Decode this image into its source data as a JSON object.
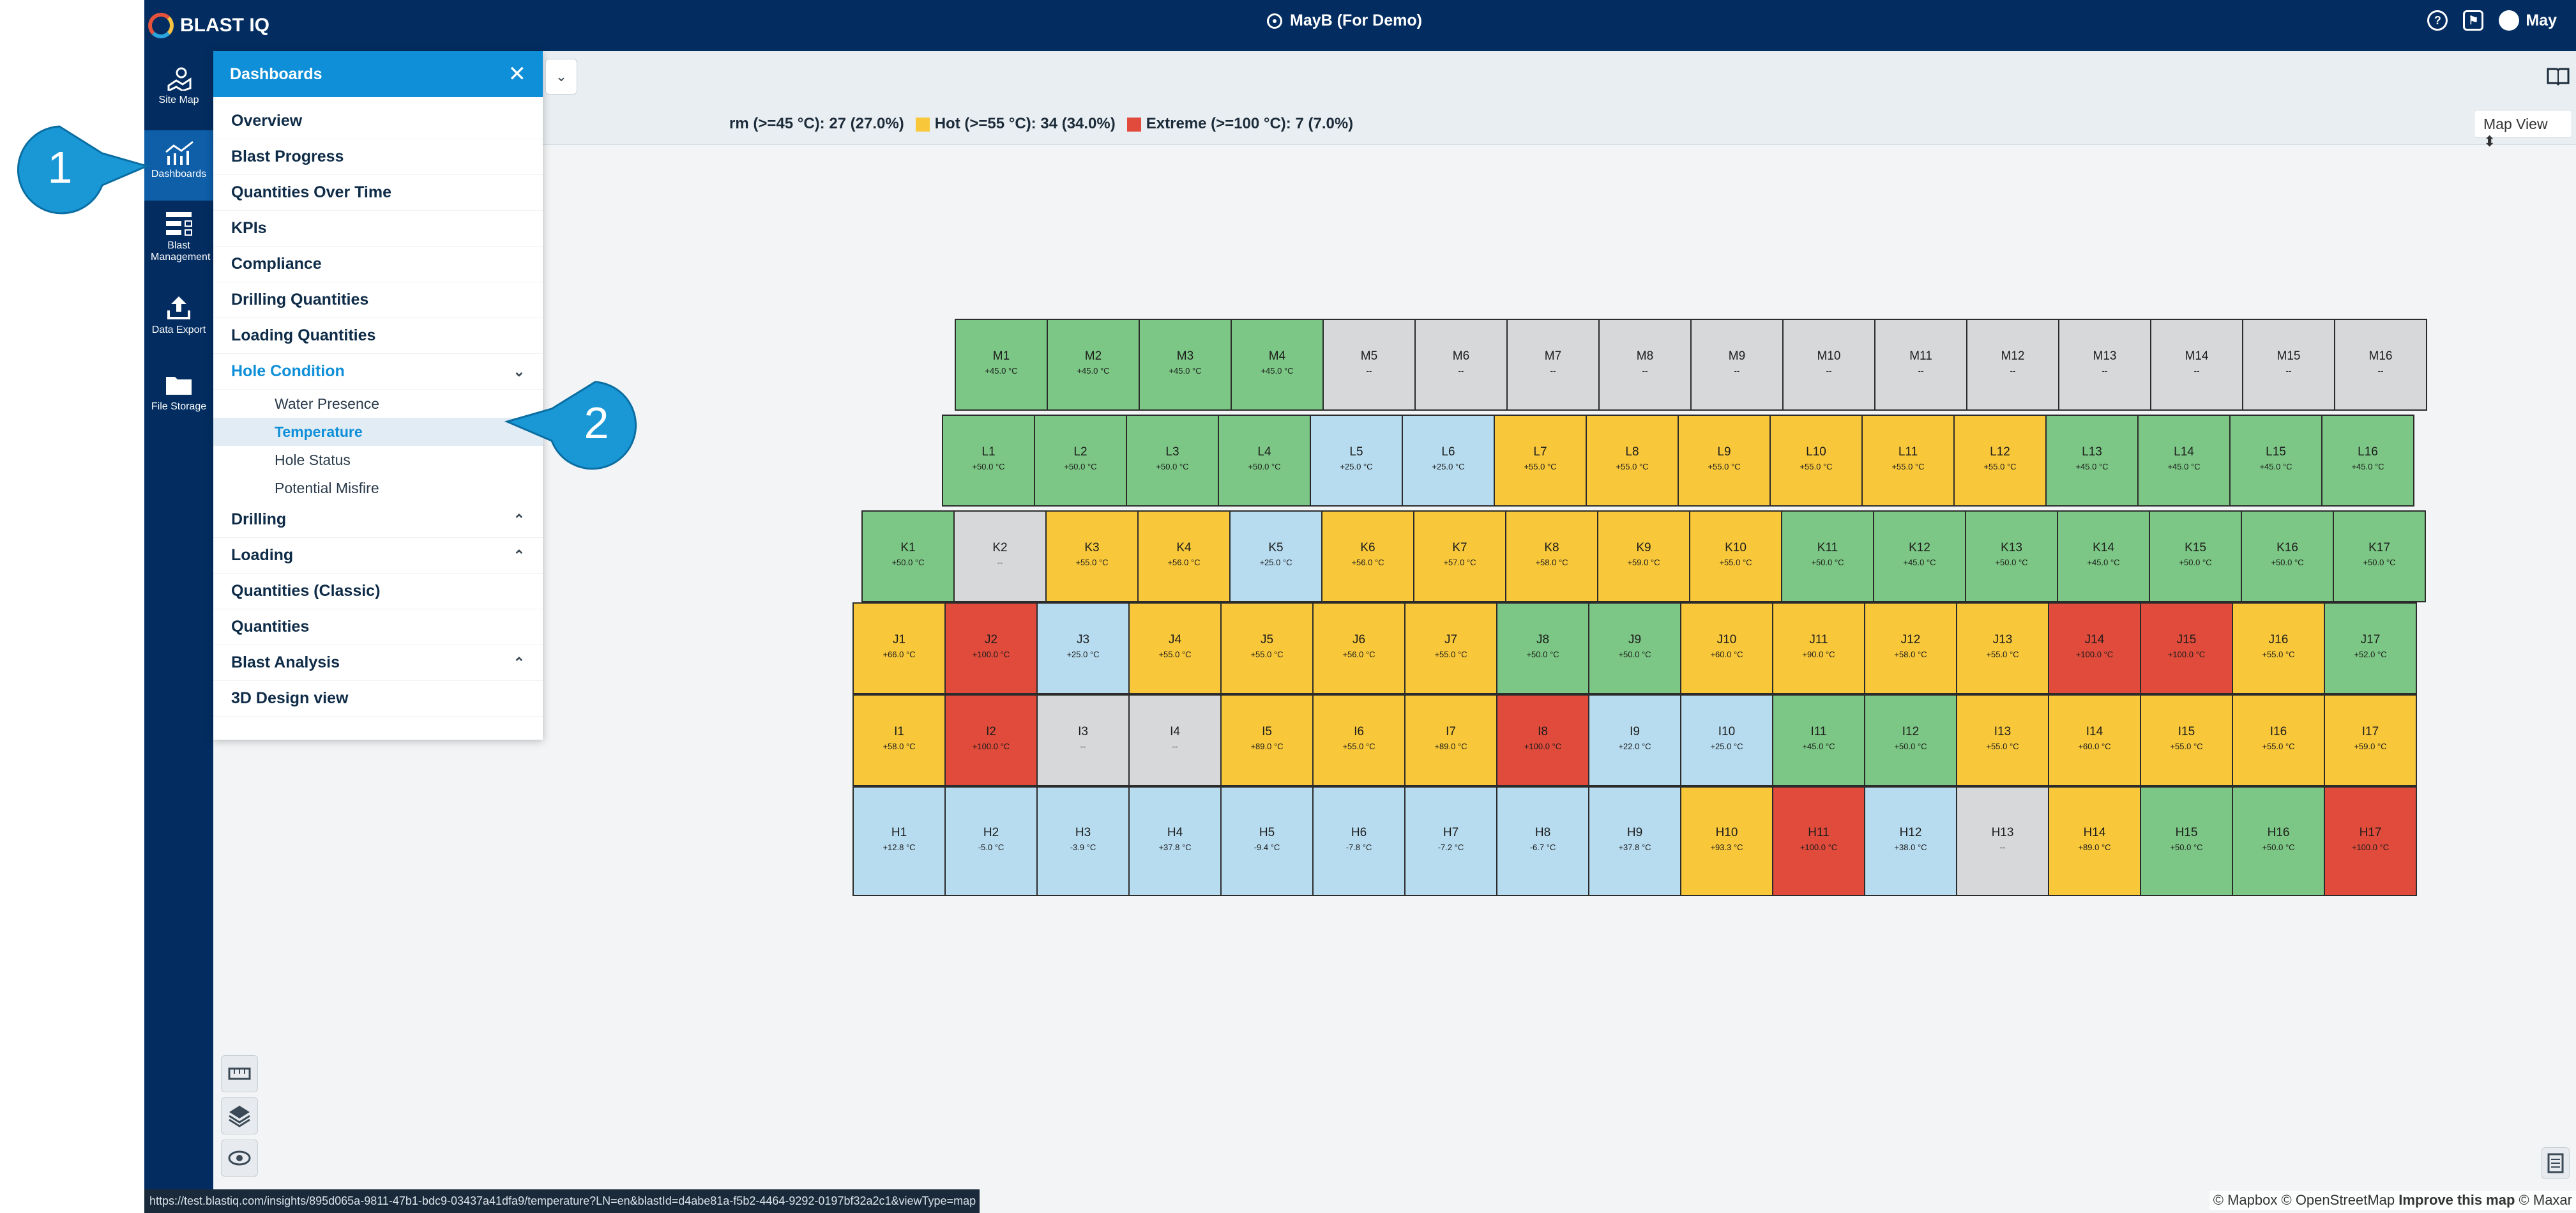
{
  "app": {
    "brand": "BLAST IQ",
    "site": "MayB (For Demo)",
    "user": "May"
  },
  "sidebar": [
    {
      "label": "Site Map",
      "icon": "map-icon"
    },
    {
      "label": "Dashboards",
      "icon": "dashboard-icon",
      "active": true
    },
    {
      "label": "Blast Management",
      "icon": "blast-management-icon"
    },
    {
      "label": "Data Export",
      "icon": "export-icon"
    },
    {
      "label": "File Storage",
      "icon": "folder-icon"
    }
  ],
  "panel": {
    "title": "Dashboards",
    "items": [
      {
        "label": "Overview"
      },
      {
        "label": "Blast Progress"
      },
      {
        "label": "Quantities Over Time"
      },
      {
        "label": "KPIs"
      },
      {
        "label": "Compliance"
      },
      {
        "label": "Drilling Quantities"
      },
      {
        "label": "Loading Quantities"
      },
      {
        "label": "Hole Condition",
        "expanded": true,
        "children": [
          "Water Presence",
          "Temperature",
          "Hole Status",
          "Potential Misfire"
        ],
        "active_child": "Temperature"
      },
      {
        "label": "Drilling",
        "collapsible": true
      },
      {
        "label": "Loading",
        "collapsible": true
      },
      {
        "label": "Quantities (Classic)"
      },
      {
        "label": "Quantities"
      },
      {
        "label": "Blast Analysis",
        "collapsible": true
      },
      {
        "label": "3D Design view"
      }
    ]
  },
  "legend": {
    "warm": "rm (>=45 °C): 27 (27.0%)",
    "hot": "Hot (>=55 °C): 34 (34.0%)",
    "extreme": "Extreme (>=100 °C): 7 (7.0%)",
    "colors": {
      "green": "#7cc785",
      "yellow": "#f9c83a",
      "red": "#e04b3b",
      "blue": "#b7dcef",
      "grey": "#d6d8da"
    }
  },
  "map_view": "Map View",
  "callouts": [
    "1",
    "2"
  ],
  "status_url": "https://test.blastiq.com/insights/895d065a-9811-47b1-bdc9-03437a41dfa9/temperature?LN=en&blastId=d4abe81a-f5b2-4464-9292-0197bf32a2c1&viewType=map",
  "copyright": {
    "mapbox": "© Mapbox",
    "osm": "© OpenStreetMap",
    "improve": "Improve this map",
    "maxar": "© Maxar"
  },
  "holes": {
    "M": [
      [
        "M1",
        "+45.0 °C",
        "green"
      ],
      [
        "M2",
        "+45.0 °C",
        "green"
      ],
      [
        "M3",
        "+45.0 °C",
        "green"
      ],
      [
        "M4",
        "+45.0 °C",
        "green"
      ],
      [
        "M5",
        "--",
        "grey"
      ],
      [
        "M6",
        "--",
        "grey"
      ],
      [
        "M7",
        "--",
        "grey"
      ],
      [
        "M8",
        "--",
        "grey"
      ],
      [
        "M9",
        "--",
        "grey"
      ],
      [
        "M10",
        "--",
        "grey"
      ],
      [
        "M11",
        "--",
        "grey"
      ],
      [
        "M12",
        "--",
        "grey"
      ],
      [
        "M13",
        "--",
        "grey"
      ],
      [
        "M14",
        "--",
        "grey"
      ],
      [
        "M15",
        "--",
        "grey"
      ],
      [
        "M16",
        "--",
        "grey"
      ]
    ],
    "L": [
      [
        "L1",
        "+50.0 °C",
        "green"
      ],
      [
        "L2",
        "+50.0 °C",
        "green"
      ],
      [
        "L3",
        "+50.0 °C",
        "green"
      ],
      [
        "L4",
        "+50.0 °C",
        "green"
      ],
      [
        "L5",
        "+25.0 °C",
        "blue"
      ],
      [
        "L6",
        "+25.0 °C",
        "blue"
      ],
      [
        "L7",
        "+55.0 °C",
        "yellow"
      ],
      [
        "L8",
        "+55.0 °C",
        "yellow"
      ],
      [
        "L9",
        "+55.0 °C",
        "yellow"
      ],
      [
        "L10",
        "+55.0 °C",
        "yellow"
      ],
      [
        "L11",
        "+55.0 °C",
        "yellow"
      ],
      [
        "L12",
        "+55.0 °C",
        "yellow"
      ],
      [
        "L13",
        "+45.0 °C",
        "green"
      ],
      [
        "L14",
        "+45.0 °C",
        "green"
      ],
      [
        "L15",
        "+45.0 °C",
        "green"
      ],
      [
        "L16",
        "+45.0 °C",
        "green"
      ]
    ],
    "K": [
      [
        "K1",
        "+50.0 °C",
        "green"
      ],
      [
        "K2",
        "--",
        "grey"
      ],
      [
        "K3",
        "+55.0 °C",
        "yellow"
      ],
      [
        "K4",
        "+56.0 °C",
        "yellow"
      ],
      [
        "K5",
        "+25.0 °C",
        "blue"
      ],
      [
        "K6",
        "+56.0 °C",
        "yellow"
      ],
      [
        "K7",
        "+57.0 °C",
        "yellow"
      ],
      [
        "K8",
        "+58.0 °C",
        "yellow"
      ],
      [
        "K9",
        "+59.0 °C",
        "yellow"
      ],
      [
        "K10",
        "+55.0 °C",
        "yellow"
      ],
      [
        "K11",
        "+50.0 °C",
        "green"
      ],
      [
        "K12",
        "+45.0 °C",
        "green"
      ],
      [
        "K13",
        "+50.0 °C",
        "green"
      ],
      [
        "K14",
        "+45.0 °C",
        "green"
      ],
      [
        "K15",
        "+50.0 °C",
        "green"
      ],
      [
        "K16",
        "+50.0 °C",
        "green"
      ],
      [
        "K17",
        "+50.0 °C",
        "green"
      ]
    ],
    "J": [
      [
        "J1",
        "+66.0 °C",
        "yellow"
      ],
      [
        "J2",
        "+100.0 °C",
        "red"
      ],
      [
        "J3",
        "+25.0 °C",
        "blue"
      ],
      [
        "J4",
        "+55.0 °C",
        "yellow"
      ],
      [
        "J5",
        "+55.0 °C",
        "yellow"
      ],
      [
        "J6",
        "+56.0 °C",
        "yellow"
      ],
      [
        "J7",
        "+55.0 °C",
        "yellow"
      ],
      [
        "J8",
        "+50.0 °C",
        "green"
      ],
      [
        "J9",
        "+50.0 °C",
        "green"
      ],
      [
        "J10",
        "+60.0 °C",
        "yellow"
      ],
      [
        "J11",
        "+90.0 °C",
        "yellow"
      ],
      [
        "J12",
        "+58.0 °C",
        "yellow"
      ],
      [
        "J13",
        "+55.0 °C",
        "yellow"
      ],
      [
        "J14",
        "+100.0 °C",
        "red"
      ],
      [
        "J15",
        "+100.0 °C",
        "red"
      ],
      [
        "J16",
        "+55.0 °C",
        "yellow"
      ],
      [
        "J17",
        "+52.0 °C",
        "green"
      ]
    ],
    "I": [
      [
        "I1",
        "+58.0 °C",
        "yellow"
      ],
      [
        "I2",
        "+100.0 °C",
        "red"
      ],
      [
        "I3",
        "--",
        "grey"
      ],
      [
        "I4",
        "--",
        "grey"
      ],
      [
        "I5",
        "+89.0 °C",
        "yellow"
      ],
      [
        "I6",
        "+55.0 °C",
        "yellow"
      ],
      [
        "I7",
        "+89.0 °C",
        "yellow"
      ],
      [
        "I8",
        "+100.0 °C",
        "red"
      ],
      [
        "I9",
        "+22.0 °C",
        "blue"
      ],
      [
        "I10",
        "+25.0 °C",
        "blue"
      ],
      [
        "I11",
        "+45.0 °C",
        "green"
      ],
      [
        "I12",
        "+50.0 °C",
        "green"
      ],
      [
        "I13",
        "+55.0 °C",
        "yellow"
      ],
      [
        "I14",
        "+60.0 °C",
        "yellow"
      ],
      [
        "I15",
        "+55.0 °C",
        "yellow"
      ],
      [
        "I16",
        "+55.0 °C",
        "yellow"
      ],
      [
        "I17",
        "+59.0 °C",
        "yellow"
      ]
    ],
    "H": [
      [
        "H1",
        "+12.8 °C",
        "blue"
      ],
      [
        "H2",
        "-5.0 °C",
        "blue"
      ],
      [
        "H3",
        "-3.9 °C",
        "blue"
      ],
      [
        "H4",
        "+37.8 °C",
        "blue"
      ],
      [
        "H5",
        "-9.4 °C",
        "blue"
      ],
      [
        "H6",
        "-7.8 °C",
        "blue"
      ],
      [
        "H7",
        "-7.2 °C",
        "blue"
      ],
      [
        "H8",
        "-6.7 °C",
        "blue"
      ],
      [
        "H9",
        "+37.8 °C",
        "blue"
      ],
      [
        "H10",
        "+93.3 °C",
        "yellow"
      ],
      [
        "H11",
        "+100.0 °C",
        "red"
      ],
      [
        "H12",
        "+38.0 °C",
        "blue"
      ],
      [
        "H13",
        "--",
        "grey"
      ],
      [
        "H14",
        "+89.0 °C",
        "yellow"
      ],
      [
        "H15",
        "+50.0 °C",
        "green"
      ],
      [
        "H16",
        "+50.0 °C",
        "green"
      ],
      [
        "H17",
        "+100.0 °C",
        "red"
      ]
    ]
  }
}
